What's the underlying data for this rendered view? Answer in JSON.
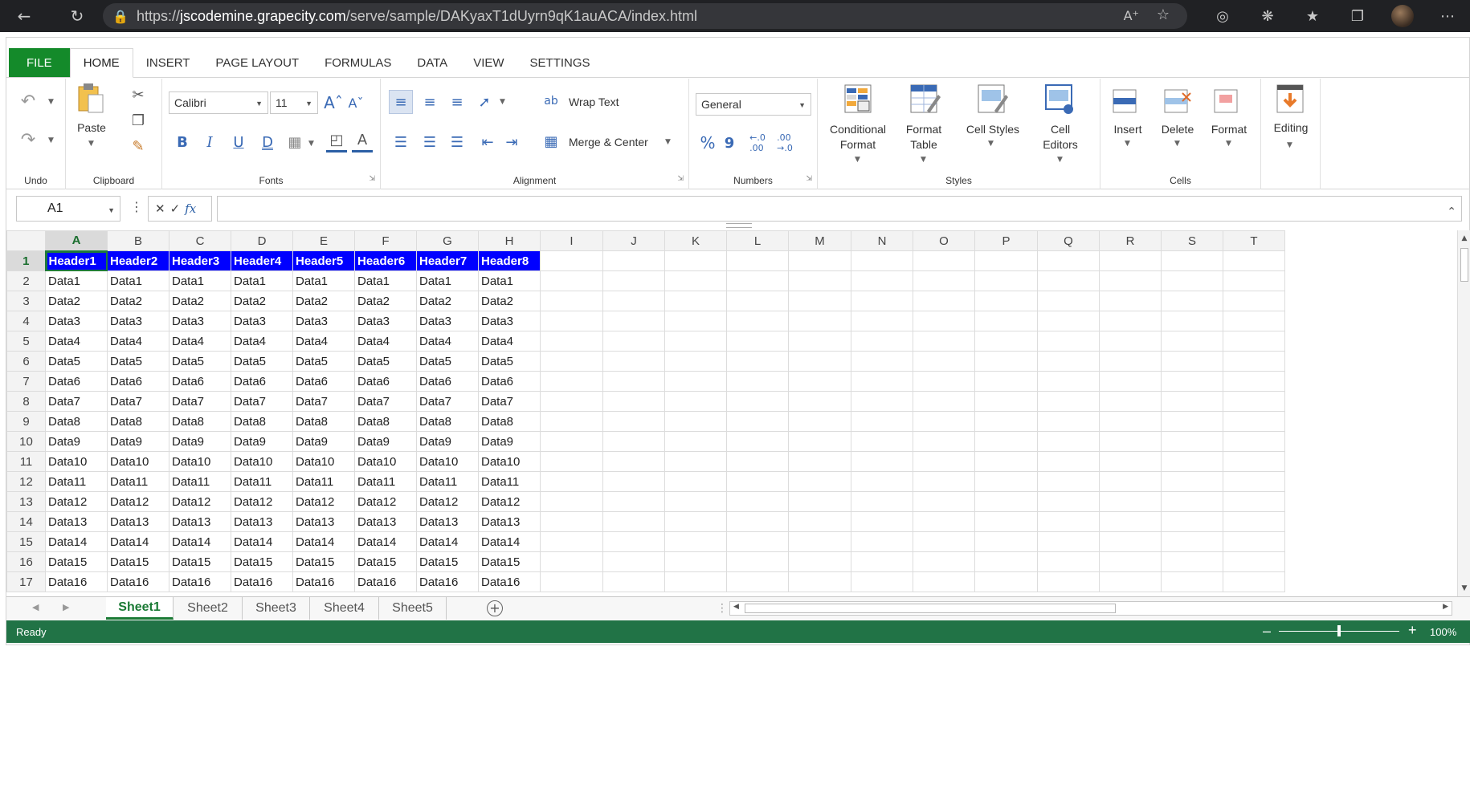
{
  "browser": {
    "url_prefix": "https://",
    "url_domain": "jscodemine.grapecity.com",
    "url_path": "/serve/sample/DAKyaxT1dUyrn9qK1auACA/index.html"
  },
  "tabs": [
    "FILE",
    "HOME",
    "INSERT",
    "PAGE LAYOUT",
    "FORMULAS",
    "DATA",
    "VIEW",
    "SETTINGS"
  ],
  "ribbon": {
    "undo_group": "Undo",
    "clipboard_group": "Clipboard",
    "paste_label": "Paste",
    "fonts_group": "Fonts",
    "font_name": "Calibri",
    "font_size": "11",
    "alignment_group": "Alignment",
    "wrap_text": "Wrap Text",
    "merge_center": "Merge & Center",
    "numbers_group": "Numbers",
    "number_format": "General",
    "percent": "%",
    "comma": "9",
    "styles_group": "Styles",
    "conditional_format": [
      "Conditional",
      "Format"
    ],
    "format_table": [
      "Format",
      "Table"
    ],
    "cell_styles": "Cell Styles",
    "cell_editors": [
      "Cell",
      "Editors"
    ],
    "cells_group": "Cells",
    "insert": "Insert",
    "delete": "Delete",
    "format": "Format",
    "editing": "Editing"
  },
  "formula_bar": {
    "name_box": "A1",
    "fx": "fx",
    "value": ""
  },
  "grid": {
    "columns": [
      "A",
      "B",
      "C",
      "D",
      "E",
      "F",
      "G",
      "H",
      "I",
      "J",
      "K",
      "L",
      "M",
      "N",
      "O",
      "P",
      "Q",
      "R",
      "S",
      "T"
    ],
    "rows": [
      [
        "Header1",
        "Header2",
        "Header3",
        "Header4",
        "Header5",
        "Header6",
        "Header7",
        "Header8"
      ],
      [
        "Data1",
        "Data1",
        "Data1",
        "Data1",
        "Data1",
        "Data1",
        "Data1",
        "Data1"
      ],
      [
        "Data2",
        "Data2",
        "Data2",
        "Data2",
        "Data2",
        "Data2",
        "Data2",
        "Data2"
      ],
      [
        "Data3",
        "Data3",
        "Data3",
        "Data3",
        "Data3",
        "Data3",
        "Data3",
        "Data3"
      ],
      [
        "Data4",
        "Data4",
        "Data4",
        "Data4",
        "Data4",
        "Data4",
        "Data4",
        "Data4"
      ],
      [
        "Data5",
        "Data5",
        "Data5",
        "Data5",
        "Data5",
        "Data5",
        "Data5",
        "Data5"
      ],
      [
        "Data6",
        "Data6",
        "Data6",
        "Data6",
        "Data6",
        "Data6",
        "Data6",
        "Data6"
      ],
      [
        "Data7",
        "Data7",
        "Data7",
        "Data7",
        "Data7",
        "Data7",
        "Data7",
        "Data7"
      ],
      [
        "Data8",
        "Data8",
        "Data8",
        "Data8",
        "Data8",
        "Data8",
        "Data8",
        "Data8"
      ],
      [
        "Data9",
        "Data9",
        "Data9",
        "Data9",
        "Data9",
        "Data9",
        "Data9",
        "Data9"
      ],
      [
        "Data10",
        "Data10",
        "Data10",
        "Data10",
        "Data10",
        "Data10",
        "Data10",
        "Data10"
      ],
      [
        "Data11",
        "Data11",
        "Data11",
        "Data11",
        "Data11",
        "Data11",
        "Data11",
        "Data11"
      ],
      [
        "Data12",
        "Data12",
        "Data12",
        "Data12",
        "Data12",
        "Data12",
        "Data12",
        "Data12"
      ],
      [
        "Data13",
        "Data13",
        "Data13",
        "Data13",
        "Data13",
        "Data13",
        "Data13",
        "Data13"
      ],
      [
        "Data14",
        "Data14",
        "Data14",
        "Data14",
        "Data14",
        "Data14",
        "Data14",
        "Data14"
      ],
      [
        "Data15",
        "Data15",
        "Data15",
        "Data15",
        "Data15",
        "Data15",
        "Data15",
        "Data15"
      ],
      [
        "Data16",
        "Data16",
        "Data16",
        "Data16",
        "Data16",
        "Data16",
        "Data16",
        "Data16"
      ]
    ],
    "header_fill": "#0000ff",
    "header_text": "#ffffff"
  },
  "sheets": [
    "Sheet1",
    "Sheet2",
    "Sheet3",
    "Sheet4",
    "Sheet5"
  ],
  "status": {
    "text": "Ready",
    "zoom": "100%"
  },
  "colors": {
    "file_tab": "#148a2a",
    "status_bar": "#217346",
    "accent": "#1a7a34"
  }
}
